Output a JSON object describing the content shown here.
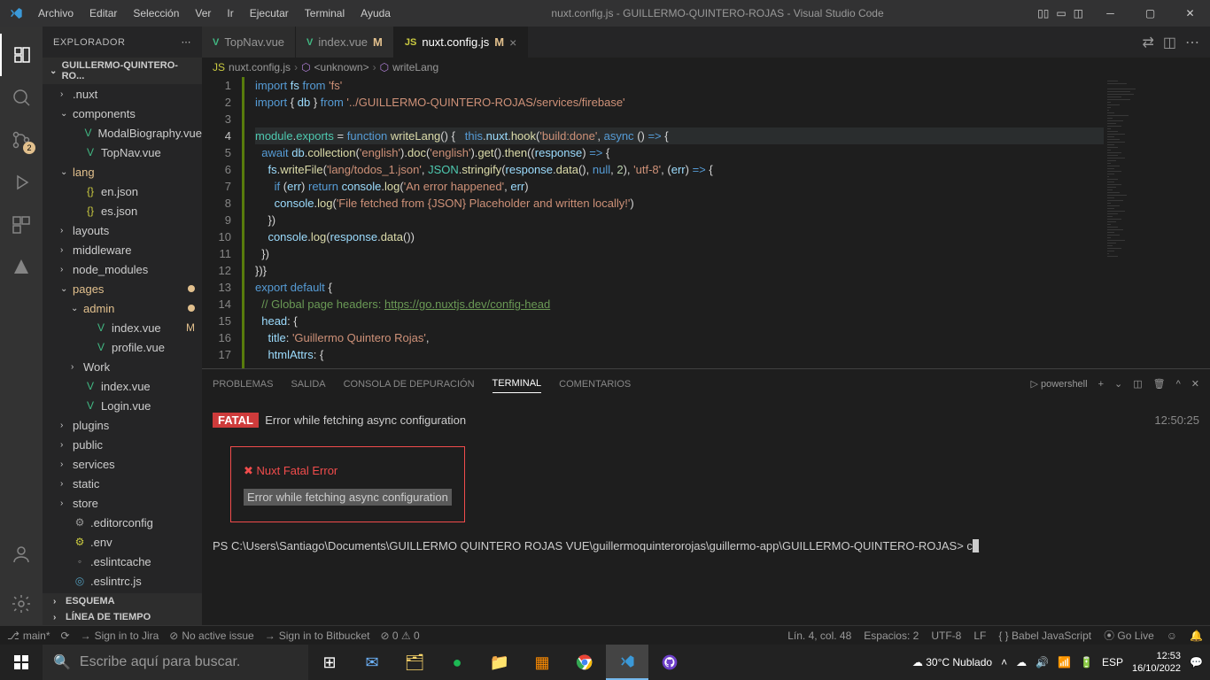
{
  "titlebar": {
    "menu": [
      "Archivo",
      "Editar",
      "Selección",
      "Ver",
      "Ir",
      "Ejecutar",
      "Terminal",
      "Ayuda"
    ],
    "title": "nuxt.config.js - GUILLERMO-QUINTERO-ROJAS - Visual Studio Code"
  },
  "activity": {
    "scm_badge": "2"
  },
  "sidebar": {
    "header": "EXPLORADOR",
    "root": "GUILLERMO-QUINTERO-RO...",
    "items": [
      {
        "d": 1,
        "chev": "›",
        "ico": "",
        "label": ".nuxt"
      },
      {
        "d": 1,
        "chev": "⌄",
        "ico": "",
        "label": "components"
      },
      {
        "d": 2,
        "chev": "",
        "ico": "V",
        "cls": "vue",
        "label": "ModalBiography.vue"
      },
      {
        "d": 2,
        "chev": "",
        "ico": "V",
        "cls": "vue",
        "label": "TopNav.vue"
      },
      {
        "d": 1,
        "chev": "⌄",
        "ico": "",
        "label": "lang",
        "open": true
      },
      {
        "d": 2,
        "chev": "",
        "ico": "{}",
        "cls": "json-ico",
        "label": "en.json"
      },
      {
        "d": 2,
        "chev": "",
        "ico": "{}",
        "cls": "json-ico",
        "label": "es.json"
      },
      {
        "d": 1,
        "chev": "›",
        "ico": "",
        "label": "layouts"
      },
      {
        "d": 1,
        "chev": "›",
        "ico": "",
        "label": "middleware"
      },
      {
        "d": 1,
        "chev": "›",
        "ico": "",
        "label": "node_modules"
      },
      {
        "d": 1,
        "chev": "⌄",
        "ico": "",
        "label": "pages",
        "open": true,
        "dot": true
      },
      {
        "d": 2,
        "chev": "⌄",
        "ico": "",
        "label": "admin",
        "open": true,
        "dot": true
      },
      {
        "d": 3,
        "chev": "",
        "ico": "V",
        "cls": "vue",
        "label": "index.vue",
        "m": "M"
      },
      {
        "d": 3,
        "chev": "",
        "ico": "V",
        "cls": "vue",
        "label": "profile.vue"
      },
      {
        "d": 2,
        "chev": "›",
        "ico": "",
        "label": "Work"
      },
      {
        "d": 2,
        "chev": "",
        "ico": "V",
        "cls": "vue",
        "label": "index.vue"
      },
      {
        "d": 2,
        "chev": "",
        "ico": "V",
        "cls": "vue",
        "label": "Login.vue"
      },
      {
        "d": 1,
        "chev": "›",
        "ico": "",
        "label": "plugins"
      },
      {
        "d": 1,
        "chev": "›",
        "ico": "",
        "label": "public"
      },
      {
        "d": 1,
        "chev": "›",
        "ico": "",
        "label": "services"
      },
      {
        "d": 1,
        "chev": "›",
        "ico": "",
        "label": "static"
      },
      {
        "d": 1,
        "chev": "›",
        "ico": "",
        "label": "store"
      },
      {
        "d": 1,
        "chev": "",
        "ico": "⚙",
        "cls": "cog",
        "label": ".editorconfig"
      },
      {
        "d": 1,
        "chev": "",
        "ico": "⚙",
        "cls": "env-ico",
        "label": ".env"
      },
      {
        "d": 1,
        "chev": "",
        "ico": "◦",
        "cls": "cog",
        "label": ".eslintcache"
      },
      {
        "d": 1,
        "chev": "",
        "ico": "◎",
        "cls": "css-ico",
        "label": ".eslintrc.js"
      }
    ],
    "sections": [
      "ESQUEMA",
      "LÍNEA DE TIEMPO"
    ]
  },
  "tabs": [
    {
      "icon": "V",
      "cls": "vue",
      "label": "TopNav.vue",
      "mod": ""
    },
    {
      "icon": "V",
      "cls": "vue",
      "label": "index.vue",
      "mod": "M"
    },
    {
      "icon": "JS",
      "cls": "js",
      "label": "nuxt.config.js",
      "mod": "M",
      "active": true
    }
  ],
  "breadcrumb": {
    "file": "nuxt.config.js",
    "sym1": "<unknown>",
    "sym2": "writeLang"
  },
  "code": {
    "cur": 4,
    "lines": [
      "1",
      "2",
      "3",
      "4",
      "5",
      "6",
      "7",
      "8",
      "9",
      "10",
      "11",
      "12",
      "13",
      "14",
      "15",
      "16",
      "17"
    ]
  },
  "panel": {
    "tabs": [
      "PROBLEMAS",
      "SALIDA",
      "CONSOLA DE DEPURACIÓN",
      "TERMINAL",
      "COMENTARIOS"
    ],
    "active": 3,
    "shell": "powershell",
    "fatal_tag": "FATAL",
    "fatal_msg": "Error while fetching async configuration",
    "timestamp": "12:50:25",
    "err_title": "✖ Nuxt Fatal Error",
    "err_msg": "Error while fetching async configuration",
    "prompt": "PS C:\\Users\\Santiago\\Documents\\GUILLERMO QUINTERO ROJAS VUE\\guillermoquinterorojas\\guillermo-app\\GUILLERMO-QUINTERO-ROJAS> ",
    "prompt_char": "c"
  },
  "status": {
    "branch": "main*",
    "sync": "⟳",
    "jira": "Sign in to Jira",
    "issue": "No active issue",
    "bb": "Sign in to Bitbucket",
    "err": "⊘ 0 ⚠ 0",
    "pos": "Lín. 4, col. 48",
    "spaces": "Espacios: 2",
    "enc": "UTF-8",
    "eol": "LF",
    "lang": "{ } Babel JavaScript",
    "live": "⦿ Go Live"
  },
  "taskbar": {
    "search": "Escribe aquí para buscar.",
    "weather": "30°C  Nublado",
    "kb": "ESP",
    "time": "12:53",
    "date": "16/10/2022"
  }
}
